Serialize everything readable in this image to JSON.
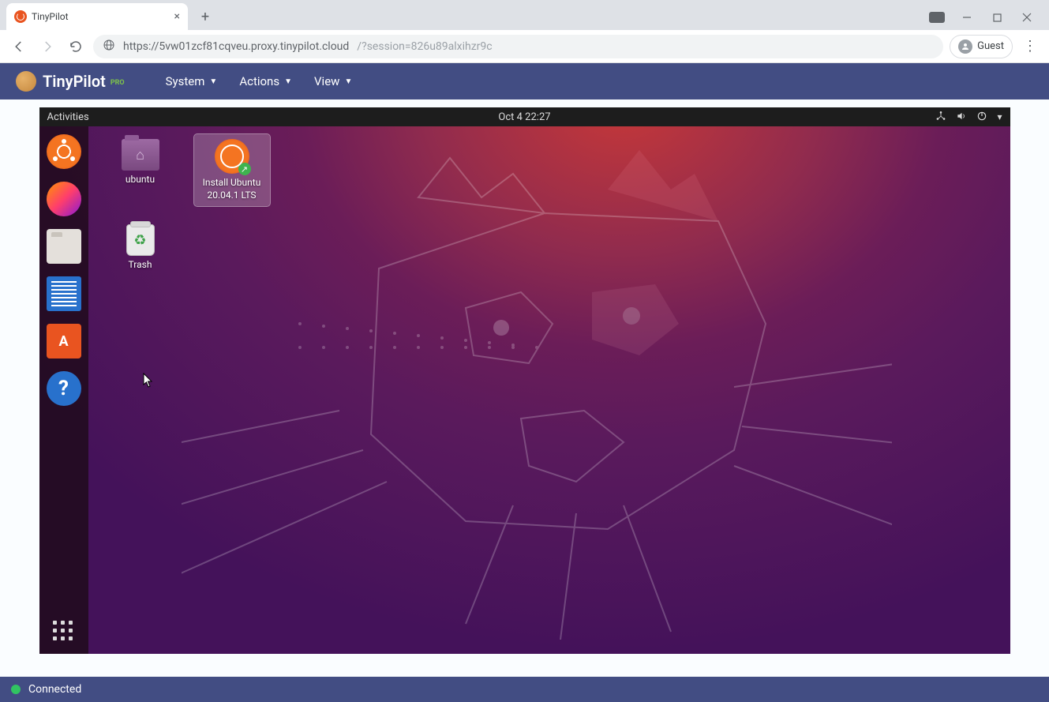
{
  "browser": {
    "tab_title": "TinyPilot",
    "url_host": "https://5vw01zcf81cqveu.proxy.tinypilot.cloud",
    "url_path": "/?session=826u89alxihzr9c",
    "guest_label": "Guest"
  },
  "tinypilot": {
    "brand": "TinyPilot",
    "brand_suffix": "PRO",
    "menu": {
      "system": "System",
      "actions": "Actions",
      "view": "View"
    },
    "status": "Connected"
  },
  "ubuntu": {
    "activities": "Activities",
    "datetime": "Oct 4  22:27",
    "desktop": {
      "home_folder": "ubuntu",
      "install": "Install Ubuntu 20.04.1 LTS",
      "trash": "Trash"
    }
  }
}
